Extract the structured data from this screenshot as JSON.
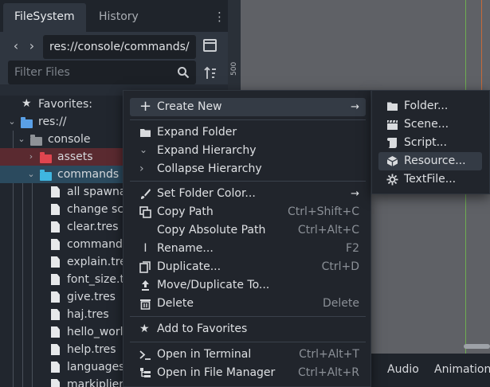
{
  "dock": {
    "tabs": [
      "FileSystem",
      "History"
    ],
    "path": "res://console/commands/",
    "filter_placeholder": "Filter Files"
  },
  "tree": {
    "favorites": "Favorites:",
    "root": "res://",
    "console": "console",
    "assets": "assets",
    "commands": "commands",
    "files": [
      "all spawna",
      "change sce",
      "clear.tres",
      "commands",
      "explain.tres",
      "font_size.tr",
      "give.tres",
      "haj.tres",
      "hello_world",
      "help.tres",
      "languages.",
      "markiplier."
    ],
    "colors": {
      "assets_folder": "#e0454f",
      "commands_folder": "#3fb6e0",
      "neutral_folder": "#8e9297",
      "root_folder": "#5aa0e6"
    }
  },
  "viewport": {
    "ruler_label": "500",
    "bottom_tabs": [
      "Audio",
      "Animation"
    ]
  },
  "menu": {
    "create_new": "Create New",
    "expand_folder": "Expand Folder",
    "expand_hierarchy": "Expand Hierarchy",
    "collapse_hierarchy": "Collapse Hierarchy",
    "set_folder_color": "Set Folder Color...",
    "copy_path": {
      "label": "Copy Path",
      "shortcut": "Ctrl+Shift+C"
    },
    "copy_absolute_path": {
      "label": "Copy Absolute Path",
      "shortcut": "Ctrl+Alt+C"
    },
    "rename": {
      "label": "Rename...",
      "shortcut": "F2"
    },
    "duplicate": {
      "label": "Duplicate...",
      "shortcut": "Ctrl+D"
    },
    "move_duplicate": "Move/Duplicate To...",
    "delete": {
      "label": "Delete",
      "shortcut": "Delete"
    },
    "add_favorites": "Add to Favorites",
    "open_terminal": {
      "label": "Open in Terminal",
      "shortcut": "Ctrl+Alt+T"
    },
    "open_file_manager": {
      "label": "Open in File Manager",
      "shortcut": "Ctrl+Alt+R"
    }
  },
  "submenu": {
    "folder": "Folder...",
    "scene": "Scene...",
    "script": "Script...",
    "resource": "Resource...",
    "textfile": "TextFile..."
  }
}
